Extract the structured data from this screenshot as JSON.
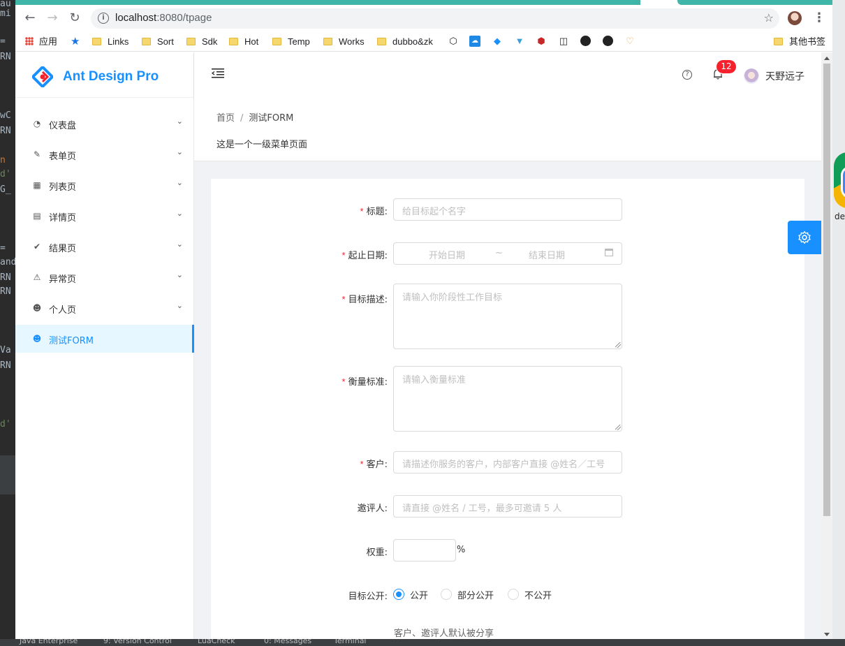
{
  "browser": {
    "url_host": "localhost",
    "url_path": ":8080/tpage",
    "bookmarks": [
      {
        "label": "应用",
        "kind": "apps"
      },
      {
        "label": "",
        "kind": "star"
      },
      {
        "label": "Links",
        "kind": "folder"
      },
      {
        "label": "Sort",
        "kind": "folder"
      },
      {
        "label": "Sdk",
        "kind": "folder"
      },
      {
        "label": "Hot",
        "kind": "folder"
      },
      {
        "label": "Temp",
        "kind": "folder"
      },
      {
        "label": "Works",
        "kind": "folder"
      },
      {
        "label": "dubbo&zk",
        "kind": "folder"
      }
    ],
    "other_bookmarks": "其他书签"
  },
  "app": {
    "logo_title": "Ant Design Pro",
    "menu": [
      {
        "label": "仪表盘",
        "icon": "dashboard-icon",
        "arrow": true
      },
      {
        "label": "表单页",
        "icon": "form-icon",
        "arrow": true
      },
      {
        "label": "列表页",
        "icon": "table-icon",
        "arrow": true
      },
      {
        "label": "详情页",
        "icon": "profile-icon",
        "arrow": true
      },
      {
        "label": "结果页",
        "icon": "check-circle-icon",
        "arrow": true
      },
      {
        "label": "异常页",
        "icon": "warning-icon",
        "arrow": true
      },
      {
        "label": "个人页",
        "icon": "user-icon",
        "arrow": true
      },
      {
        "label": "测试FORM",
        "icon": "user-icon",
        "arrow": false,
        "active": true
      }
    ],
    "header": {
      "notification_count": "12",
      "username": "天野远子"
    },
    "breadcrumb": {
      "home": "首页",
      "sep": "/",
      "current": "测试FORM"
    },
    "page_description": "这是一个一级菜单页面"
  },
  "form": {
    "title": {
      "label": "标题:",
      "required": "*",
      "placeholder": "给目标起个名字"
    },
    "date": {
      "label": "起止日期:",
      "required": "*",
      "start_placeholder": "开始日期",
      "sep": "~",
      "end_placeholder": "结束日期"
    },
    "goal": {
      "label": "目标描述:",
      "required": "*",
      "placeholder": "请输入你阶段性工作目标"
    },
    "standard": {
      "label": "衡量标准:",
      "required": "*",
      "placeholder": "请输入衡量标准"
    },
    "client": {
      "label": "客户:",
      "required": "*",
      "placeholder": "请描述你服务的客户，内部客户直接 @姓名／工号"
    },
    "invites": {
      "label": "邀评人:",
      "placeholder": "请直接 @姓名 / 工号，最多可邀请 5 人"
    },
    "weight": {
      "label": "权重:",
      "unit": "%"
    },
    "public": {
      "label": "目标公开:",
      "options": [
        "公开",
        "部分公开",
        "不公开"
      ],
      "selected": "公开",
      "help": "客户、邀评人默认被分享"
    }
  },
  "ide": {
    "taskbar": [
      "Java Enterprise",
      "9: Version Control",
      "LuaCheck",
      "0: Messages",
      "Terminal"
    ]
  },
  "desktop": {
    "text": "de"
  }
}
